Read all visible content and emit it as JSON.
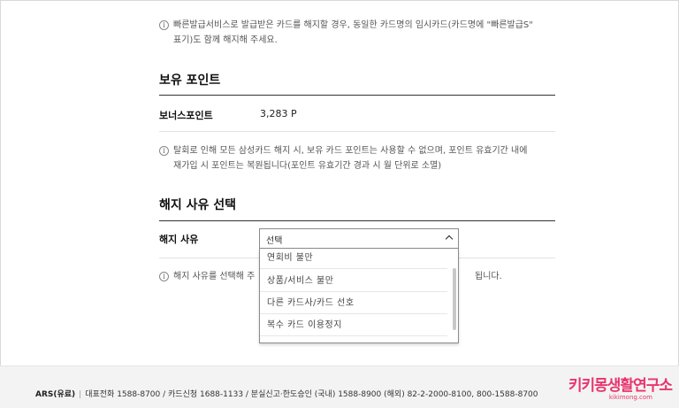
{
  "notice_top": {
    "icon": "info-circle-icon",
    "line1": "빠른발급서비스로 발급받은 카드를 해지할 경우, 동일한 카드명의 임시카드(카드명에 \"빠른발급S\"",
    "line2": "표기)도 함께 해지해 주세요."
  },
  "points": {
    "title": "보유 포인트",
    "label": "보너스포인트",
    "value": "3,283 P",
    "notice_line1": "탈회로 인해 모든 삼성카드 해지 시, 보유 카드 포인트는 사용할 수 없으며, 포인트 유효기간 내에",
    "notice_line2": "재가입 시 포인트는 복원됩니다(포인트 유효기간 경과 시 월 단위로 소멸)"
  },
  "reason": {
    "title": "해지 사유 선택",
    "label": "해지 사유",
    "selected": "선택",
    "notice_start": "해지 사유를 선택해 주",
    "notice_end": "됩니다.",
    "options": [
      "연회비 불만",
      "상품/서비스 불만",
      "다른 카드사/카드 선호",
      "복수 카드 이용정지"
    ]
  },
  "footer": {
    "ars_label": "ARS(유료)",
    "text": "대표전화 1588-8700 / 카드신청 1688-1133 / 분실신고·한도승인 (국내) 1588-8900 (해외) 82-2-2000-8100, 800-1588-8700"
  },
  "watermark": {
    "brand": "키키몽생활연구소",
    "url": "kikimong.com"
  }
}
